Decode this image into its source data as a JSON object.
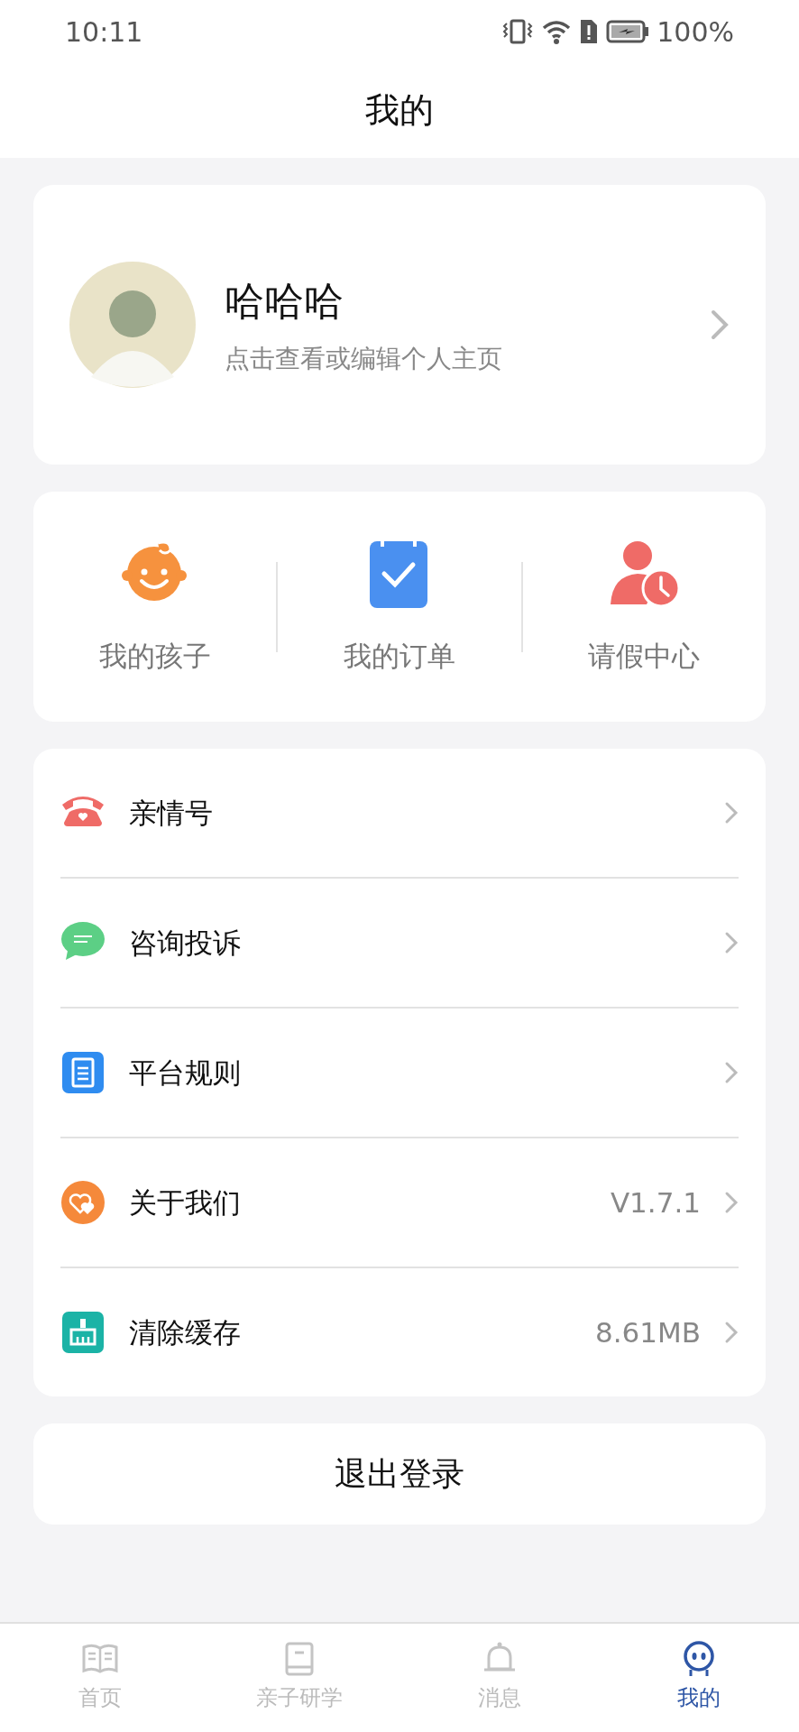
{
  "status_bar": {
    "time": "10:11",
    "battery": "100%"
  },
  "header": {
    "title": "我的"
  },
  "profile": {
    "name": "哈哈哈",
    "subtitle": "点击查看或编辑个人主页"
  },
  "shortcuts": [
    {
      "kind": "child",
      "label": "我的孩子"
    },
    {
      "kind": "order",
      "label": "我的订单"
    },
    {
      "kind": "leave",
      "label": "请假中心"
    }
  ],
  "menu": [
    {
      "kind": "phone",
      "label": "亲情号"
    },
    {
      "kind": "chat",
      "label": "咨询投诉"
    },
    {
      "kind": "rules",
      "label": "平台规则"
    },
    {
      "kind": "about",
      "label": "关于我们",
      "value": "V1.7.1"
    },
    {
      "kind": "clean",
      "label": "清除缓存",
      "value": "8.61MB"
    }
  ],
  "logout": {
    "label": "退出登录"
  },
  "tab_bar": [
    {
      "kind": "home",
      "label": "首页",
      "selected": false
    },
    {
      "kind": "study",
      "label": "亲子研学",
      "selected": false
    },
    {
      "kind": "messages",
      "label": "消息",
      "selected": false
    },
    {
      "kind": "mine",
      "label": "我的",
      "selected": true
    }
  ]
}
